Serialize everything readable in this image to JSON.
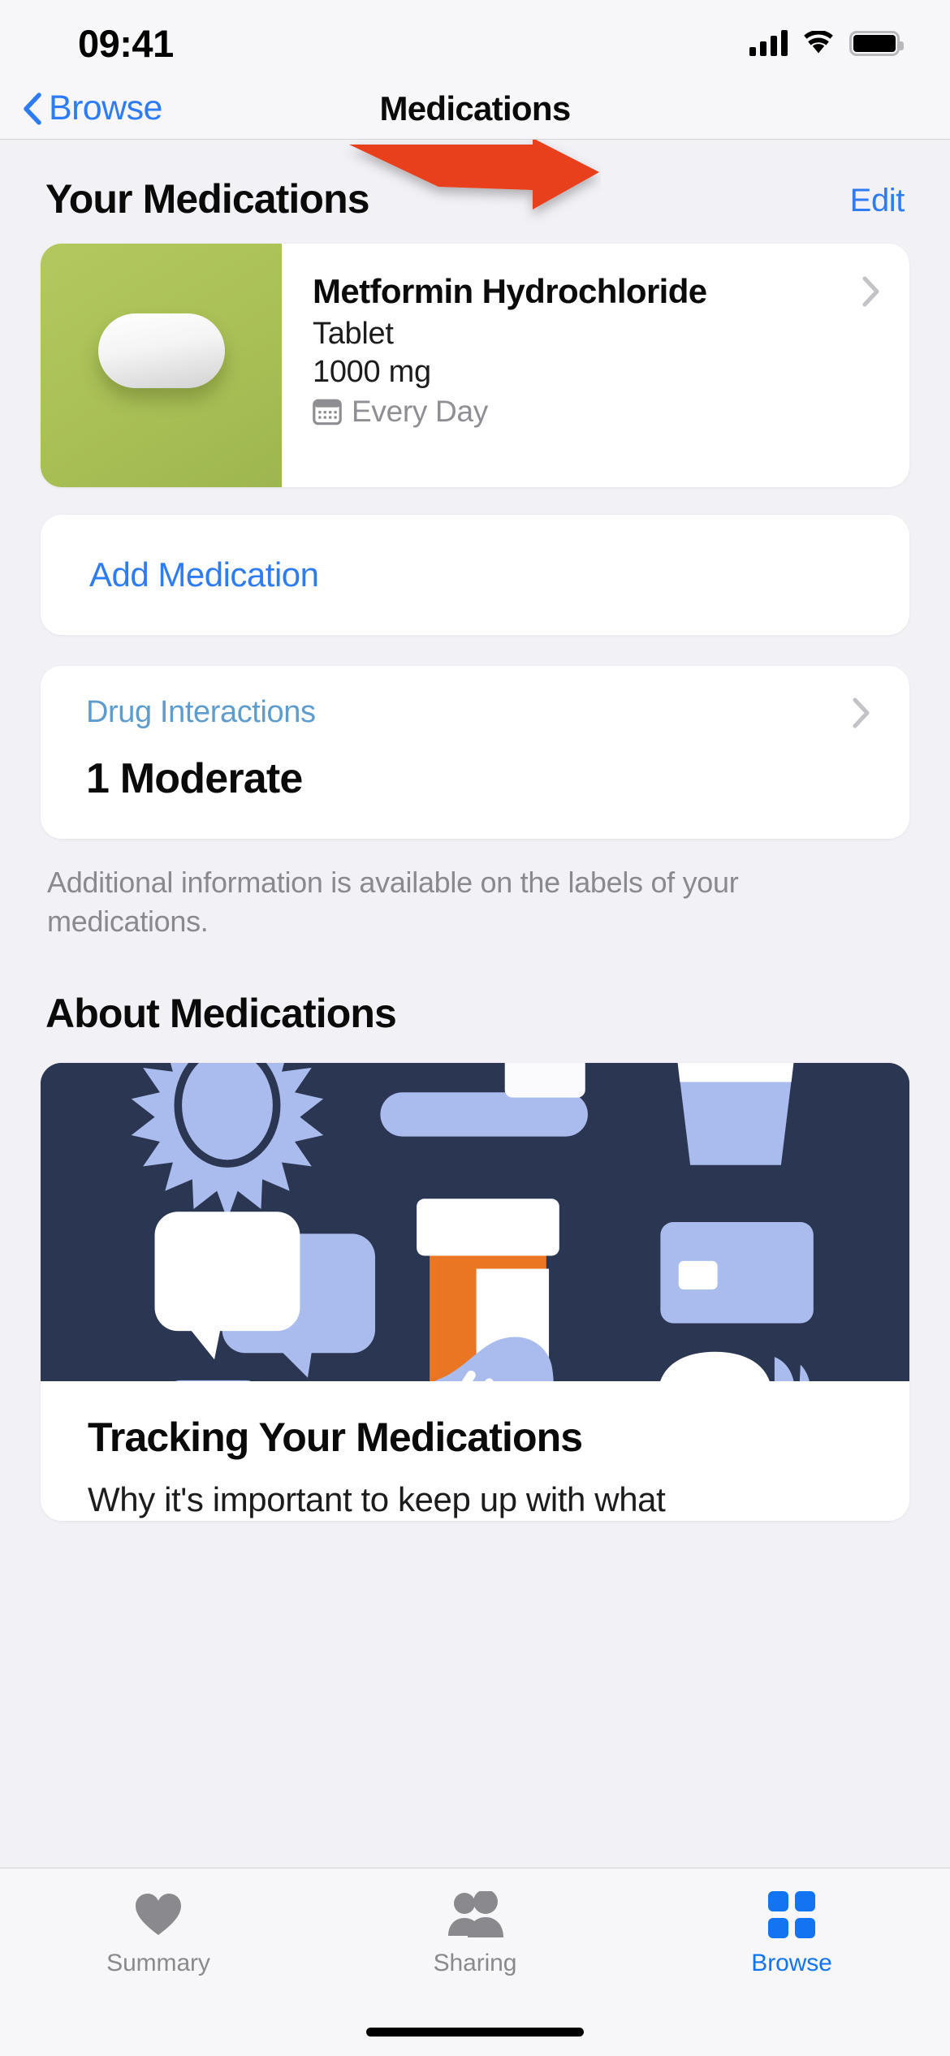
{
  "status_bar": {
    "time": "09:41",
    "cellular_icon": "signal-bars-icon",
    "wifi_icon": "wifi-icon",
    "battery_icon": "battery-full-icon"
  },
  "nav_bar": {
    "back_icon": "chevron-left-icon",
    "back_label": "Browse",
    "title": "Medications"
  },
  "your_medications": {
    "section_title": "Your Medications",
    "edit_label": "Edit",
    "medications": [
      {
        "name": "Metformin Hydrochloride",
        "form": "Tablet",
        "dose": "1000 mg",
        "schedule": "Every Day",
        "schedule_icon": "calendar-icon",
        "thumb_icon": "pill-tablet-icon",
        "thumb_color": "#a9c056",
        "disclosure_icon": "chevron-right-icon"
      }
    ],
    "add_medication_label": "Add Medication"
  },
  "drug_interactions": {
    "title": "Drug Interactions",
    "title_color": "#5d9ccd",
    "count_label": "1 Moderate",
    "disclosure_icon": "chevron-right-icon"
  },
  "footnote": "Additional information is available on the labels of your medications.",
  "about_medications": {
    "section_title": "About Medications",
    "hero": {
      "background_color": "#2b3752",
      "accent_color": "#aabcee",
      "orange_color": "#ea7522",
      "icons": [
        "sun-icon",
        "toothbrush-icon",
        "water-glass-icon",
        "speech-bubbles-icon",
        "pill-bottle-icon",
        "credit-card-icon",
        "key-icon",
        "sneaker-icon",
        "bread-icon"
      ]
    },
    "article_title": "Tracking Your Medications",
    "article_subtitle": "Why it's important to keep up with what"
  },
  "annotation": {
    "arrow_icon": "red-arrow-icon",
    "arrow_color": "#e8411e",
    "points_at": "Edit"
  },
  "tab_bar": {
    "tabs": [
      {
        "label": "Summary",
        "icon": "heart-icon",
        "active": false
      },
      {
        "label": "Sharing",
        "icon": "people-icon",
        "active": false
      },
      {
        "label": "Browse",
        "icon": "grid-squares-icon",
        "active": true
      }
    ],
    "active_color": "#1274f0",
    "inactive_color": "#8a8a8e"
  }
}
